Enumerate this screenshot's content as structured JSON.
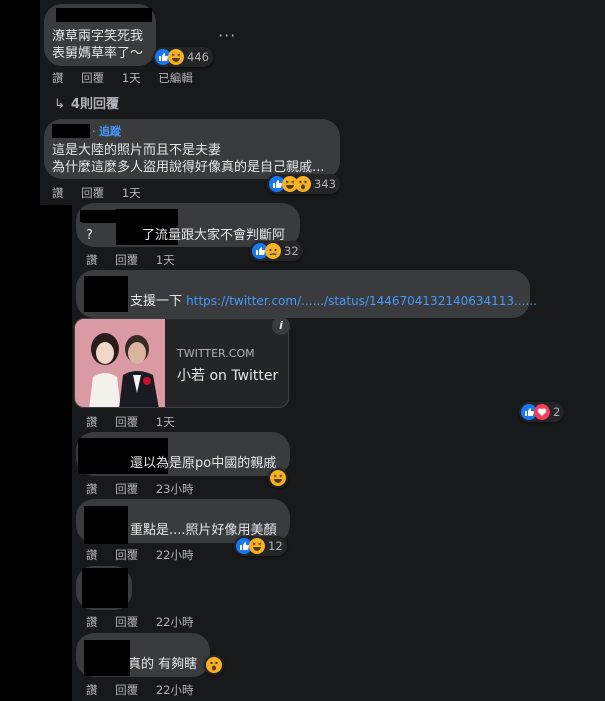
{
  "comments": [
    {
      "text_lines": [
        "潦草兩字笑死我",
        "表舅媽草率了～"
      ],
      "reaction_count": "446",
      "actions": [
        "讚",
        "回覆",
        "1天",
        "已編輯"
      ],
      "reactions": [
        "like-icon",
        "haha-icon"
      ]
    },
    {
      "follow_label": "追蹤",
      "text_lines": [
        "這是大陸的照片而且不是夫妻",
        "為什麼這麼多人盜用說得好像真的是自己親戚..."
      ],
      "reaction_count": "343",
      "actions": [
        "讚",
        "回覆",
        "1天"
      ],
      "reactions": [
        "like-icon",
        "haha-icon",
        "wow-icon"
      ]
    }
  ],
  "replies_link": "4則回覆",
  "replies": [
    {
      "text": "了流量跟大家不會判斷阿",
      "prefix": "?",
      "reaction_count": "32",
      "actions": [
        "讚",
        "回覆",
        "1天"
      ],
      "reactions": [
        "like-icon",
        "sad-icon"
      ]
    },
    {
      "text": "支援一下",
      "link": "https://twitter.com/....../status/1446704132140634113......",
      "card": {
        "domain": "TWITTER.COM",
        "title": "小若 on Twitter"
      },
      "actions": [
        "讚",
        "回覆",
        "1天"
      ],
      "side_reaction_count": "2",
      "side_reactions": [
        "like-icon",
        "love-icon"
      ]
    },
    {
      "text": "還以為是原po中國的親戚",
      "actions": [
        "讚",
        "回覆",
        "23小時"
      ],
      "reactions": [
        "haha-icon"
      ]
    },
    {
      "text": "重點是....照片好像用美顏",
      "reaction_count": "12",
      "actions": [
        "讚",
        "回覆",
        "22小時"
      ],
      "reactions": [
        "like-icon",
        "haha-icon"
      ]
    },
    {
      "text": "",
      "actions": [
        "讚",
        "回覆",
        "22小時"
      ]
    },
    {
      "text": "真的 有夠瞎",
      "actions": [
        "讚",
        "回覆",
        "22小時"
      ],
      "reactions": [
        "wow-icon"
      ]
    }
  ],
  "colors": {
    "background": "#18191a",
    "bubble": "#3a3b3c",
    "link": "#4599ff",
    "like": "#1877f2",
    "love": "#f33e58",
    "haha": "#f7b125"
  }
}
